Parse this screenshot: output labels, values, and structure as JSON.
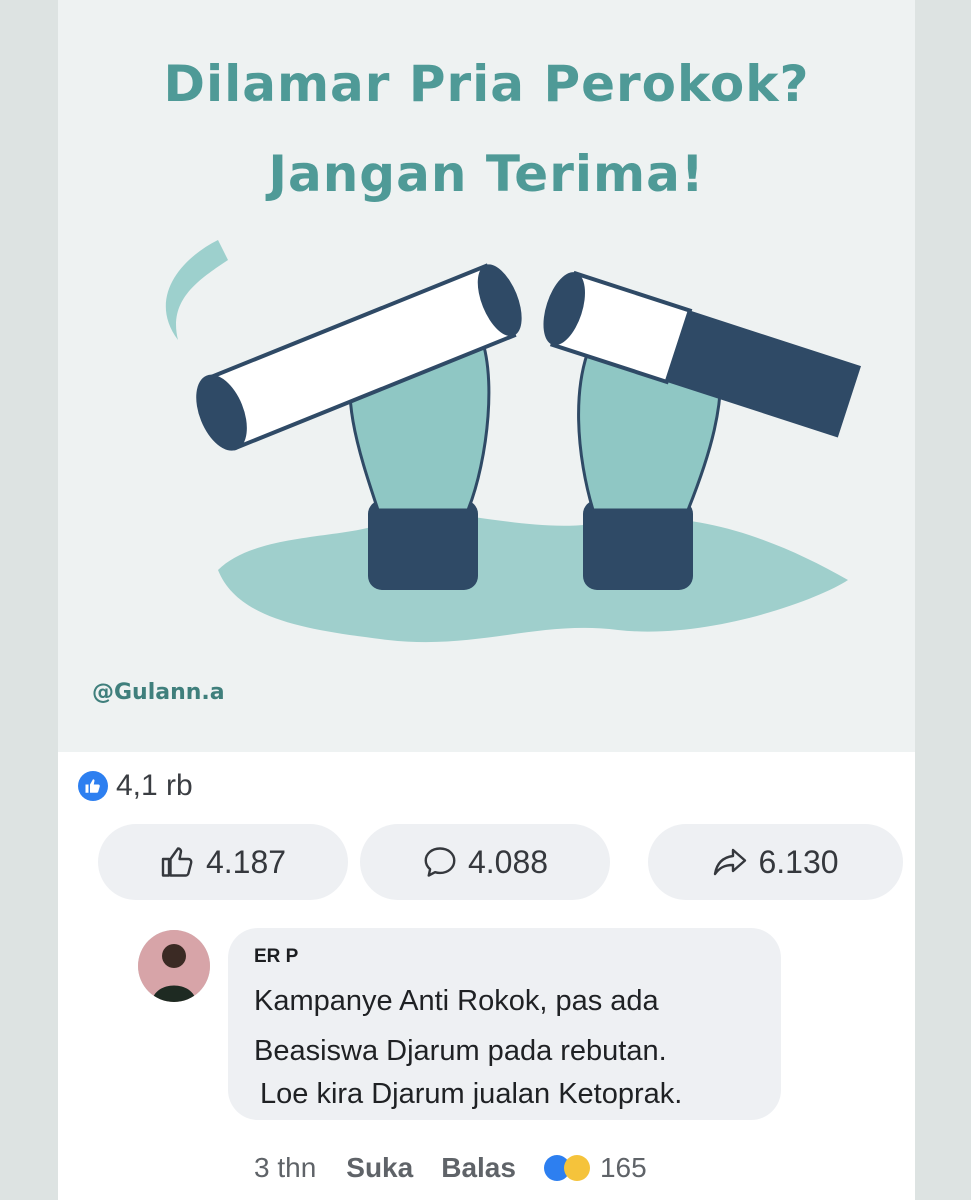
{
  "poster": {
    "title_line1": "Dilamar Pria Perokok?",
    "title_line2": "Jangan Terima!",
    "credit": "@Gulann.a",
    "colors": {
      "teal": "#4f9a97",
      "navy": "#2f4a66",
      "light_teal": "#8fc7c4"
    }
  },
  "post": {
    "reaction_icon": "like-icon",
    "reaction_count": "4,1 rb",
    "actions": {
      "like": {
        "icon": "thumbs-up-icon",
        "count": "4.187"
      },
      "comment": {
        "icon": "comment-icon",
        "count": "4.088"
      },
      "share": {
        "icon": "share-icon",
        "count": "6.130"
      }
    }
  },
  "comment": {
    "author": "ER P",
    "lines": [
      "Kampanye Anti Rokok, pas ada",
      "Beasiswa Djarum pada rebutan.",
      "Loe kira Djarum jualan Ketoprak."
    ],
    "time": "3 thn",
    "like_label": "Suka",
    "reply_label": "Balas",
    "reaction_icons": [
      "like-icon",
      "haha-icon"
    ],
    "reaction_count": "165"
  }
}
